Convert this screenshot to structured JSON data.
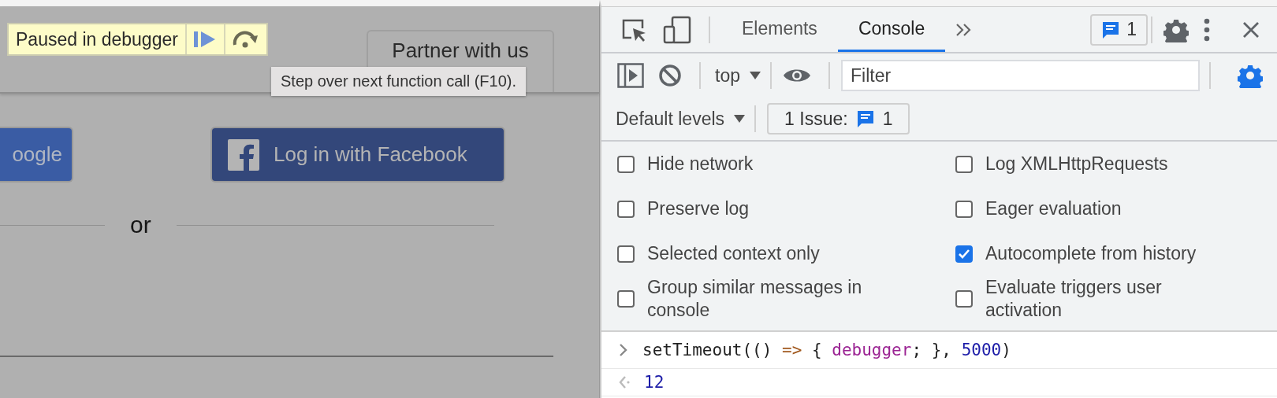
{
  "page": {
    "paused_banner": {
      "text": "Paused in debugger"
    },
    "partner_button": "Partner with us",
    "tooltip": "Step over next function call (F10).",
    "google_button": "oogle",
    "facebook_button": "Log in with Facebook",
    "divider_text": "or"
  },
  "devtools": {
    "tabs": [
      {
        "label": "Elements",
        "selected": false
      },
      {
        "label": "Console",
        "selected": true
      }
    ],
    "messages_badge": "1",
    "context": "top",
    "filter": {
      "placeholder": "Filter"
    },
    "console_settings_open": true,
    "levels": "Default levels",
    "issues_button": {
      "label": "1 Issue:",
      "count": "1"
    },
    "settings": [
      {
        "label": "Hide network",
        "checked": false
      },
      {
        "label": "Log XMLHttpRequests",
        "checked": false
      },
      {
        "label": "Preserve log",
        "checked": false
      },
      {
        "label": "Eager evaluation",
        "checked": false
      },
      {
        "label": "Selected context only",
        "checked": false
      },
      {
        "label": "Autocomplete from history",
        "checked": true
      },
      {
        "label": "Group similar messages in console",
        "checked": false
      },
      {
        "label": "Evaluate triggers user activation",
        "checked": false
      }
    ],
    "console": [
      {
        "kind": "input",
        "tokens": [
          {
            "color": "#222222",
            "text": "setTimeout(() "
          },
          {
            "color": "#a0571c",
            "text": "=>"
          },
          {
            "color": "#222222",
            "text": " { "
          },
          {
            "color": "#9b2393",
            "text": "debugger"
          },
          {
            "color": "#222222",
            "text": "; }, "
          },
          {
            "color": "#1c1ca8",
            "text": "5000"
          },
          {
            "color": "#222222",
            "text": ")"
          }
        ]
      },
      {
        "kind": "result",
        "tokens": [
          {
            "color": "#1c1ca8",
            "text": "12"
          }
        ]
      }
    ]
  }
}
